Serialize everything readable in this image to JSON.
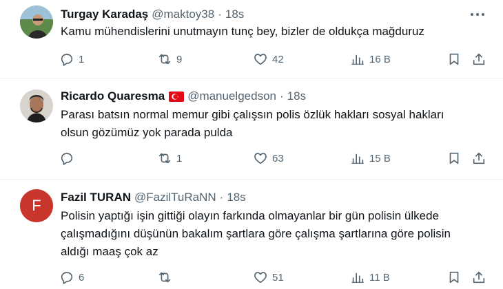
{
  "tweets": [
    {
      "name": "Turgay Karadaş",
      "handle": "@maktoy38",
      "separator": "·",
      "time": "18s",
      "lines": [
        "Kamu mühendislerini unutmayın tunç bey, bizler de oldukça mağduruz"
      ],
      "replies": "1",
      "retweets": "9",
      "likes": "42",
      "views": "16 B"
    },
    {
      "name": "Ricardo Quaresma",
      "handle": "@manuelgedson",
      "separator": "·",
      "time": "18s",
      "flag_icon": "turkey-flag-icon",
      "lines": [
        "Parası batsın normal memur gibi çalışsın polis özlük hakları sosyal hakları",
        "olsun gözümüz yok parada pulda"
      ],
      "replies": "",
      "retweets": "1",
      "likes": "63",
      "views": "15 B"
    },
    {
      "name": "Fazil TURAN",
      "handle": "@FazilTuRaNN",
      "separator": "·",
      "time": "18s",
      "avatar_letter": "F",
      "avatar_color": "#c8352a",
      "lines": [
        "Polisin yaptığı işin gittiği olayın farkında olmayanlar bir gün polisin ülkede",
        "çalışmadığını düşünün bakalım şartlara göre çalışma şartlarına göre polisin",
        "aldığı maaş çok az"
      ],
      "replies": "6",
      "retweets": "",
      "likes": "51",
      "views": "11 B"
    }
  ],
  "colors": {
    "text": "#0f1419",
    "muted": "#536471",
    "divider": "#eff3f4"
  }
}
